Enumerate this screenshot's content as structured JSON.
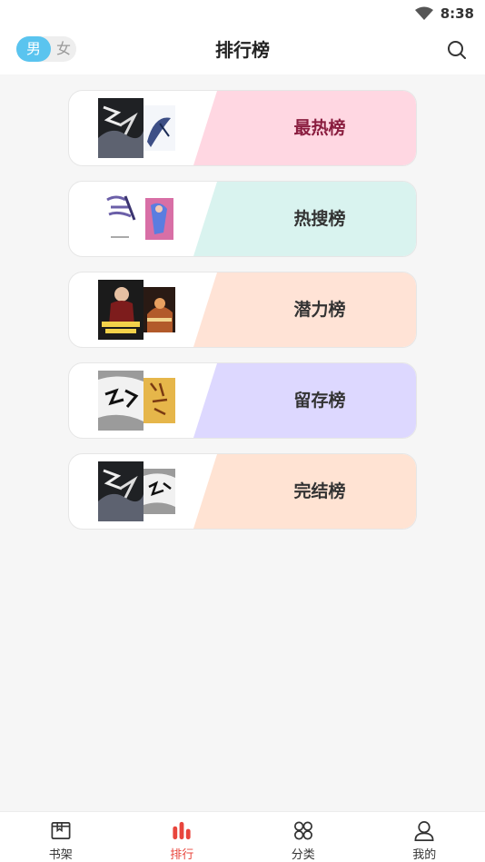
{
  "status": {
    "time": "8:38"
  },
  "header": {
    "title": "排行榜",
    "gender_male": "男",
    "gender_female": "女"
  },
  "rankings": [
    {
      "label": "最热榜",
      "band_color": "#ffd7e2",
      "label_color": "#8a1d3f"
    },
    {
      "label": "热搜榜",
      "band_color": "#d9f3ef",
      "label_color": "#333333"
    },
    {
      "label": "潜力榜",
      "band_color": "#ffe3d6",
      "label_color": "#333333"
    },
    {
      "label": "留存榜",
      "band_color": "#ddd8ff",
      "label_color": "#333333"
    },
    {
      "label": "完结榜",
      "band_color": "#ffe3d3",
      "label_color": "#333333"
    }
  ],
  "tabbar": {
    "items": [
      {
        "label": "书架",
        "icon": "bookshelf-icon"
      },
      {
        "label": "排行",
        "icon": "ranking-icon"
      },
      {
        "label": "分类",
        "icon": "category-icon"
      },
      {
        "label": "我的",
        "icon": "profile-icon"
      }
    ]
  },
  "colors": {
    "accent": "#e8453c",
    "gender_active": "#5ac4ef"
  }
}
